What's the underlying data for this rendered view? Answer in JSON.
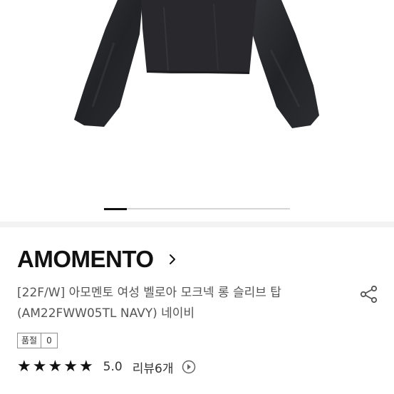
{
  "product": {
    "brand": "AMOMENTO",
    "title_line1": "[22F/W] 아모멘토 여성 벨로아 모크넥 롱 슬리브 탑",
    "title_line2": "(AM22FWW05TL NAVY) 네이비"
  },
  "quality": {
    "label": "품절",
    "value": "0"
  },
  "rating": {
    "stars": "★",
    "score": "5.0",
    "reviews": "리뷰6개"
  },
  "icons": {
    "brand_link": "chevron-right-icon",
    "share": "share-icon",
    "review_link": "circle-play-icon"
  },
  "colors": {
    "garment": "#26272b",
    "text_primary": "#111111",
    "text_secondary": "#555555",
    "divider": "#f3f3f3"
  }
}
